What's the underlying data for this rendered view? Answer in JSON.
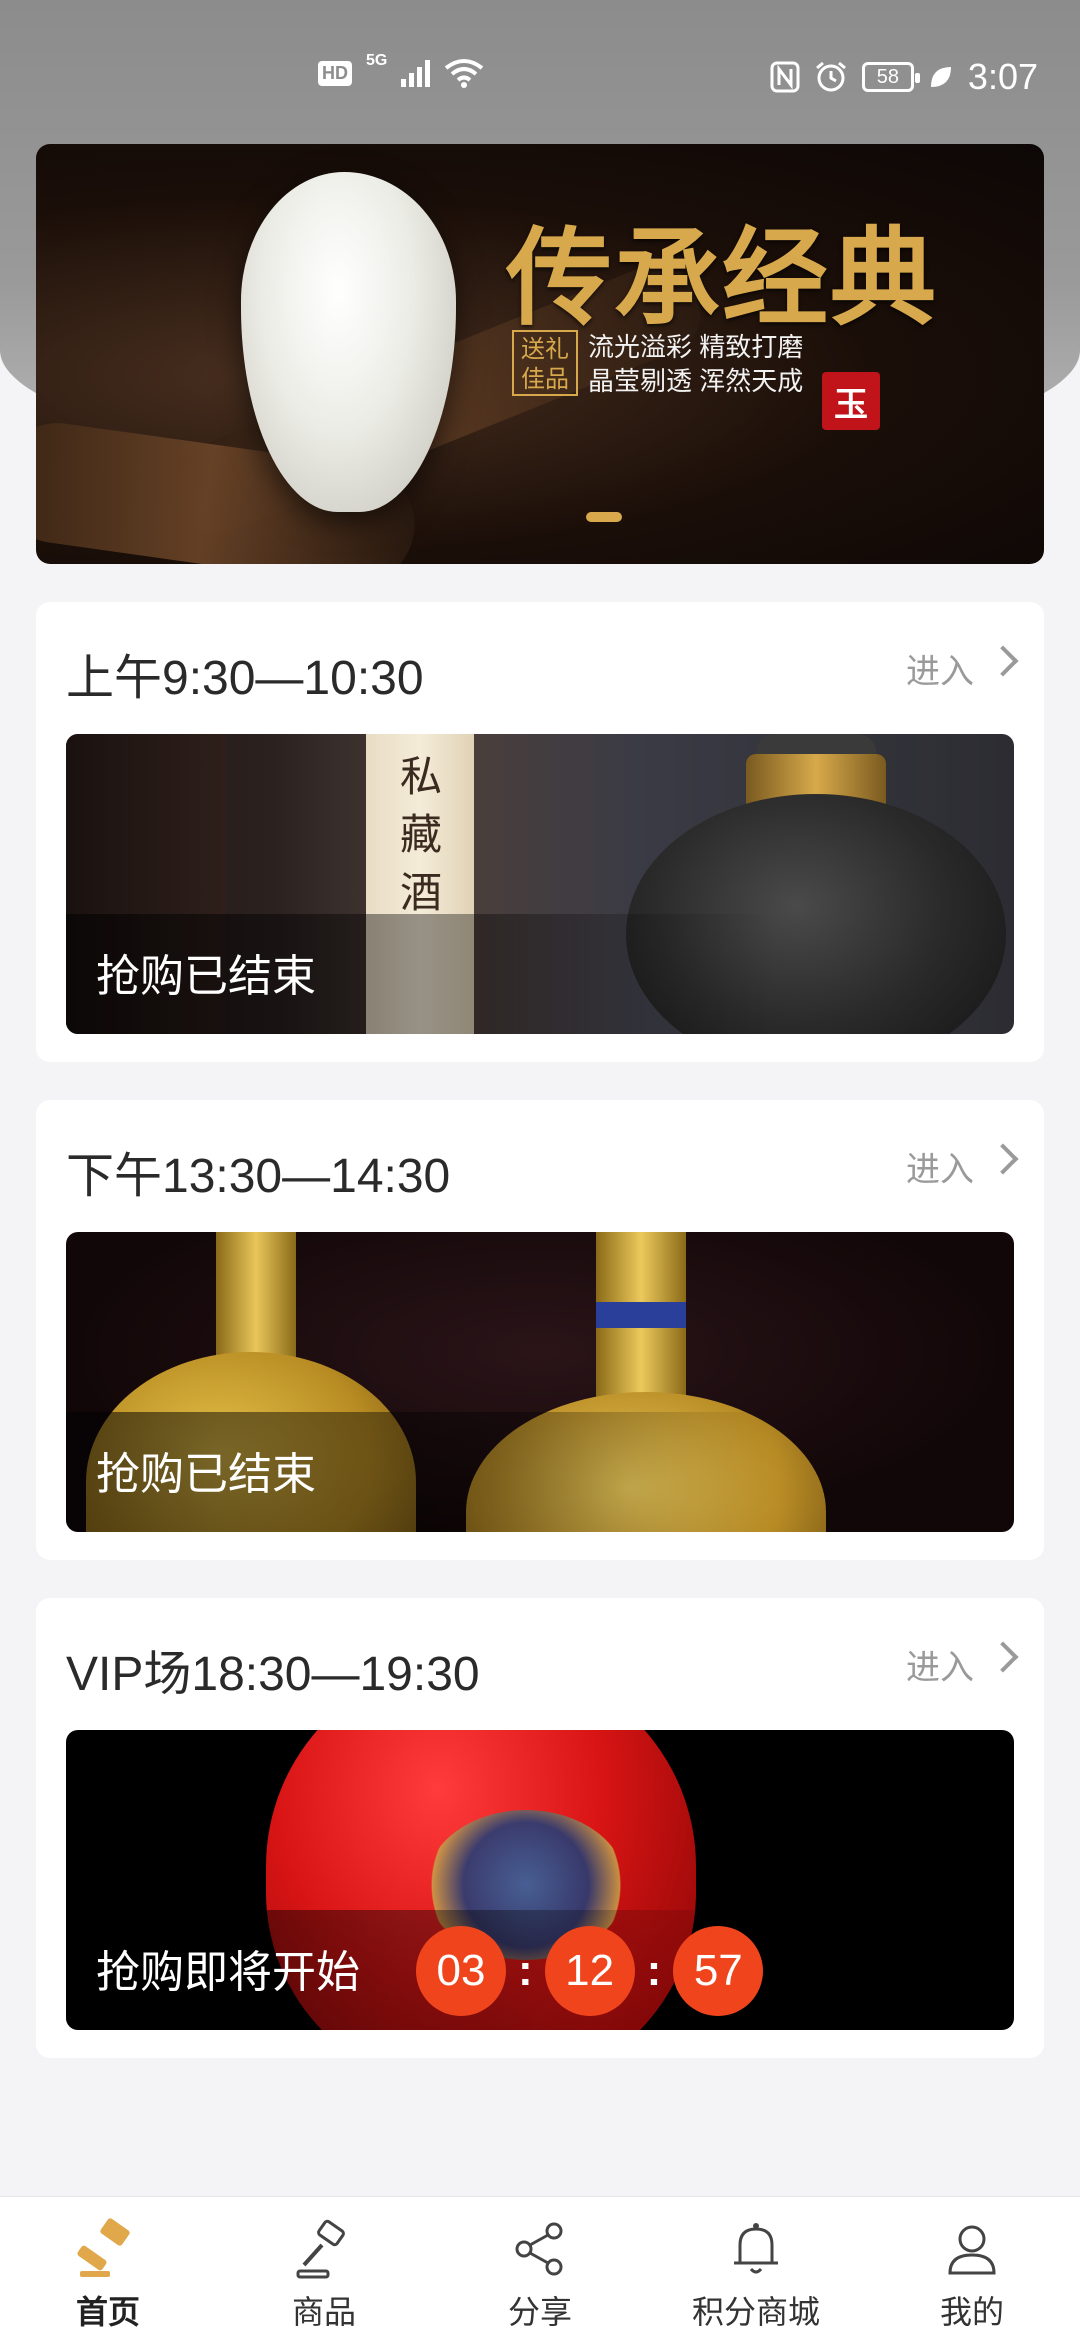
{
  "status_bar": {
    "hd": "HD",
    "network": "5G",
    "battery": "58",
    "time": "3:07"
  },
  "banner": {
    "title": "传承经典",
    "badge": "送礼佳品",
    "subtitle_line1": "流光溢彩 精致打磨",
    "subtitle_line2": "晶莹剔透 浑然天成",
    "seal": "玉"
  },
  "sessions": [
    {
      "title": "上午9:30—10:30",
      "enter": "进入",
      "status": "抢购已结束",
      "image_text": "私藏酒"
    },
    {
      "title": "下午13:30—14:30",
      "enter": "进入",
      "status": "抢购已结束"
    },
    {
      "title": "VIP场18:30—19:30",
      "enter": "进入",
      "status": "抢购即将开始",
      "countdown": {
        "h": "03",
        "sep1": ":",
        "m": "12",
        "sep2": ":",
        "s": "57"
      }
    }
  ],
  "colors": {
    "accent": "#d8a94c",
    "countdown": "#f0451c"
  },
  "nav": [
    {
      "label": "首页",
      "icon": "gavel-icon",
      "active": true
    },
    {
      "label": "商品",
      "icon": "gavel-outline-icon",
      "active": false
    },
    {
      "label": "分享",
      "icon": "share-icon",
      "active": false
    },
    {
      "label": "积分商城",
      "icon": "bell-icon",
      "active": false
    },
    {
      "label": "我的",
      "icon": "user-icon",
      "active": false
    }
  ]
}
